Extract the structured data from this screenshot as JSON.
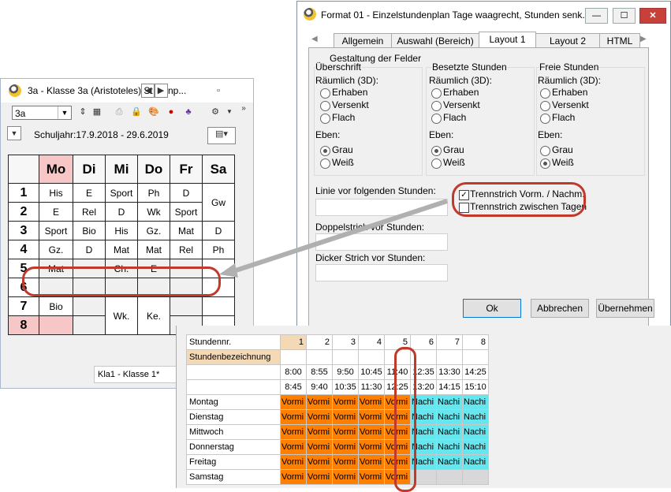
{
  "left_window": {
    "title": "3a - Klasse 3a (Aristoteles)",
    "title_overflow": "St",
    "title_tail": "np...",
    "class_combo": "3a",
    "schuljahr": "Schuljahr:17.9.2018 - 29.6.2019",
    "status_field": "Kla1 - Klasse 1*",
    "days": [
      "Mo",
      "Di",
      "Mi",
      "Do",
      "Fr",
      "Sa"
    ],
    "periods": [
      "1",
      "2",
      "3",
      "4",
      "5",
      "6",
      "7",
      "8"
    ],
    "rows": [
      [
        "His",
        "E",
        "Sport",
        "Ph",
        "D"
      ],
      [
        "E",
        "Rel",
        "D",
        "Wk",
        "Sport"
      ],
      [
        "Sport",
        "Bio",
        "His",
        "Gz.",
        "Mat",
        "D"
      ],
      [
        "Gz.",
        "D",
        "Mat",
        "Mat",
        "Rel",
        "Ph"
      ],
      [
        "Mat",
        "",
        "Ch.",
        "E",
        "",
        ""
      ],
      [
        "",
        "",
        "",
        "",
        "",
        ""
      ],
      [
        "Bio",
        "",
        "Wk.",
        "Ke.",
        "",
        ""
      ],
      [
        "",
        "",
        "",
        "",
        "",
        ""
      ]
    ],
    "sa_merged": "Gw"
  },
  "dialog": {
    "title": "Format 01 - Einzelstundenplan Tage waagrecht, Stunden senk...",
    "tabs": [
      "Allgemein",
      "Auswahl (Bereich)",
      "Layout 1",
      "Layout 2",
      "HTML"
    ],
    "active_tab": "Layout 1",
    "section_title": "Gestaltung der Felder",
    "groups": [
      {
        "title": "Überschrift",
        "subtitle": "Räumlich (3D):",
        "options": [
          "Erhaben",
          "Versenkt",
          "Flach"
        ],
        "eben": "Eben:",
        "eben_options": [
          "Grau",
          "Weiß"
        ],
        "eben_selected": "Grau"
      },
      {
        "title": "Besetzte Stunden",
        "subtitle": "Räumlich (3D):",
        "options": [
          "Erhaben",
          "Versenkt",
          "Flach"
        ],
        "eben": "Eben:",
        "eben_options": [
          "Grau",
          "Weiß"
        ],
        "eben_selected": "Grau"
      },
      {
        "title": "Freie Stunden",
        "subtitle": "Räumlich (3D):",
        "options": [
          "Erhaben",
          "Versenkt",
          "Flach"
        ],
        "eben": "Eben:",
        "eben_options": [
          "Grau",
          "Weiß"
        ],
        "eben_selected": "Weiß"
      }
    ],
    "linie_label": "Linie vor folgenden Stunden:",
    "doppelstrich_label": "Doppelstrich vor Stunden:",
    "dicker_label": "Dicker Strich vor Stunden:",
    "chk_trennstrich_vorm": "Trennstrich Vorm. / Nachm.",
    "chk_trennstrich_vorm_checked": true,
    "chk_trennstrich_tage": "Trennstrich zwischen Tagen",
    "chk_trennstrich_tage_checked": false,
    "ok": "Ok",
    "abbrechen": "Abbrechen",
    "uebernehmen": "Übernehmen",
    "minimize_glyph": "—",
    "maximize_glyph": "☐",
    "close_glyph": "✕"
  },
  "grid": {
    "header_label": "Stundennr.",
    "numbers": [
      "1",
      "2",
      "3",
      "4",
      "5",
      "6",
      "7",
      "8"
    ],
    "bezeichnung_label": "Stundenbezeichnung",
    "start_times": [
      "8:00",
      "8:55",
      "9:50",
      "10:45",
      "11:40",
      "12:35",
      "13:30",
      "14:25"
    ],
    "end_times": [
      "8:45",
      "9:40",
      "10:35",
      "11:30",
      "12:25",
      "13:20",
      "14:15",
      "15:10"
    ],
    "days": [
      "Montag",
      "Dienstag",
      "Mittwoch",
      "Donnerstag",
      "Freitag",
      "Samstag"
    ],
    "vm_label": "Vormi",
    "nm_label": "Nachi",
    "colors": {
      "vormittag": "#ff7f00",
      "nachmittag": "#66e6ee",
      "highlight": "#c0392b"
    }
  }
}
